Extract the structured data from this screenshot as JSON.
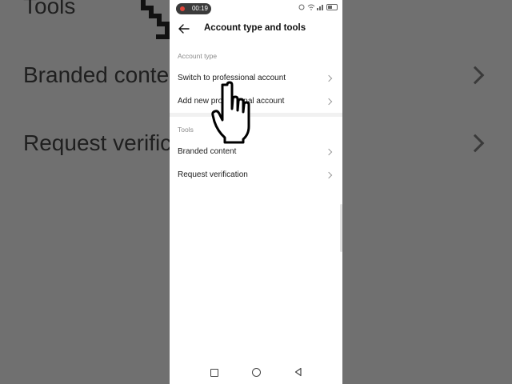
{
  "background": {
    "tools_heading": "Tools",
    "item_branded": "Branded conte",
    "item_request": "Request verific"
  },
  "status_bar": {
    "recording_time": "00:19"
  },
  "header": {
    "title": "Account type and tools"
  },
  "sections": [
    {
      "label": "Account type",
      "items": [
        {
          "label": "Switch to professional account"
        },
        {
          "label": "Add new professional account"
        }
      ]
    },
    {
      "label": "Tools",
      "items": [
        {
          "label": "Branded content"
        },
        {
          "label": "Request verification"
        }
      ]
    }
  ],
  "colors": {
    "accent_text": "#111111",
    "section_label": "#8a8a8a",
    "recording_dot": "#e0453a"
  },
  "icons": [
    "back-arrow-icon",
    "chevron-right-icon",
    "hand-pointer-cursor-icon"
  ]
}
